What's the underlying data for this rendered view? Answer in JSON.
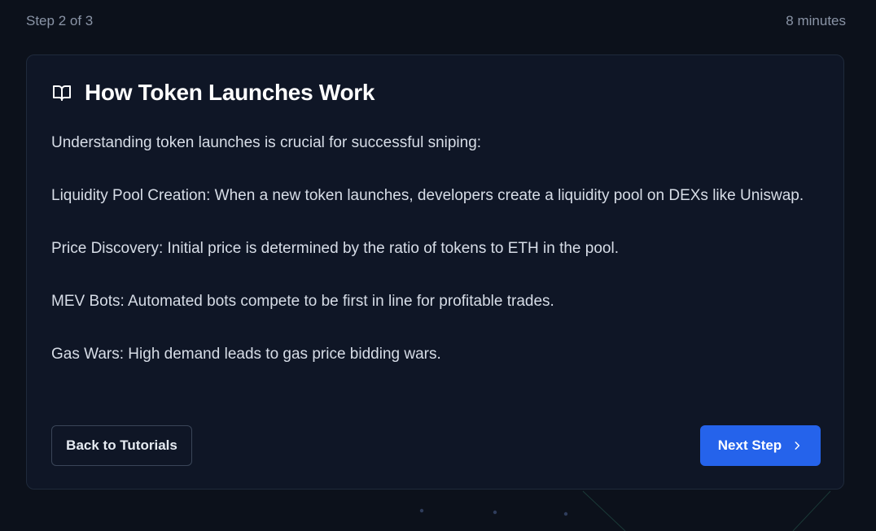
{
  "header": {
    "step_label": "Step 2 of 3",
    "duration": "8 minutes"
  },
  "card": {
    "icon": "book-open-icon",
    "title": "How Token Launches Work",
    "paragraphs": [
      "Understanding token launches is crucial for successful sniping:",
      "Liquidity Pool Creation: When a new token launches, developers create a liquidity pool on DEXs like Uniswap.",
      "Price Discovery: Initial price is determined by the ratio of tokens to ETH in the pool.",
      "MEV Bots: Automated bots compete to be first in line for profitable trades.",
      "Gas Wars: High demand leads to gas price bidding wars."
    ]
  },
  "actions": {
    "back_label": "Back to Tutorials",
    "next_label": "Next Step",
    "next_icon": "chevron-right-icon"
  },
  "colors": {
    "background": "#0c111b",
    "card": "#0f1626",
    "accent": "#2563eb"
  }
}
